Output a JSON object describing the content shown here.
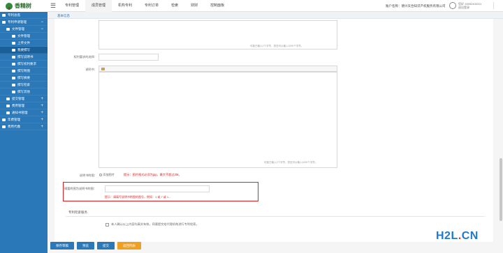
{
  "brand": {
    "name": "香精树"
  },
  "nav": [
    "专利管理",
    "成员管理",
    "机构专利",
    "专利订单",
    "检索",
    "财财",
    "控制面板"
  ],
  "account": {
    "label": "账户名称：",
    "company": "德兴天合知识产权服务有限公司"
  },
  "user": {
    "line1": "您好  15952400311",
    "line2": "退出登录"
  },
  "sidebar": [
    {
      "label": "专利总揽",
      "level": 0
    },
    {
      "label": "专利申请管理",
      "level": 0,
      "exp": "−"
    },
    {
      "label": "文件管理",
      "level": 1,
      "exp": "−"
    },
    {
      "label": "文件管理",
      "level": 2
    },
    {
      "label": "上传文件",
      "level": 2
    },
    {
      "label": "我要撰写",
      "level": 2,
      "selected": true
    },
    {
      "label": "撰写说明书",
      "level": 2
    },
    {
      "label": "撰写权利要求",
      "level": 2
    },
    {
      "label": "撰写附图",
      "level": 2
    },
    {
      "label": "撰写摘要",
      "level": 2
    },
    {
      "label": "撰写检索",
      "level": 2
    },
    {
      "label": "撰写其他",
      "level": 2
    },
    {
      "label": "提交管理",
      "level": 1,
      "exp": "+"
    },
    {
      "label": "费用管理",
      "level": 1,
      "exp": "+"
    },
    {
      "label": "通知书管理",
      "level": 1,
      "exp": "+"
    },
    {
      "label": "年费管理",
      "level": 0,
      "exp": "+"
    },
    {
      "label": "费用代缴",
      "level": 0,
      "exp": "+"
    }
  ],
  "tab": {
    "home": "基本信息"
  },
  "form": {
    "hint1": "可能已输入0个字符，您还可以输入1000个字符。",
    "label_qa": "权利要求的选择：",
    "label_desc": "说明书：",
    "hint2": "可能已输入0个字符，您还可以输入1000个字符。",
    "label_fig": "说明书附图：",
    "upload_label": "添加图片",
    "upload_hint": "提示：图片格式必须为jpg，最大不超过2M。",
    "label_abs": "摘要附图为说明书附图：",
    "abs_hint": "提示：请填写说明书附图的图号，例如：1 或 7 或 1...",
    "section": "专利检索服务",
    "agree_text": "本人确认以上内容均真实有效，同意提交给代理机构进行专利检索。"
  },
  "buttons": [
    "保存草稿",
    "预览",
    "提交",
    "返回列表"
  ],
  "watermark": {
    "a": "H2L",
    "b": ".",
    "c": "CN"
  }
}
